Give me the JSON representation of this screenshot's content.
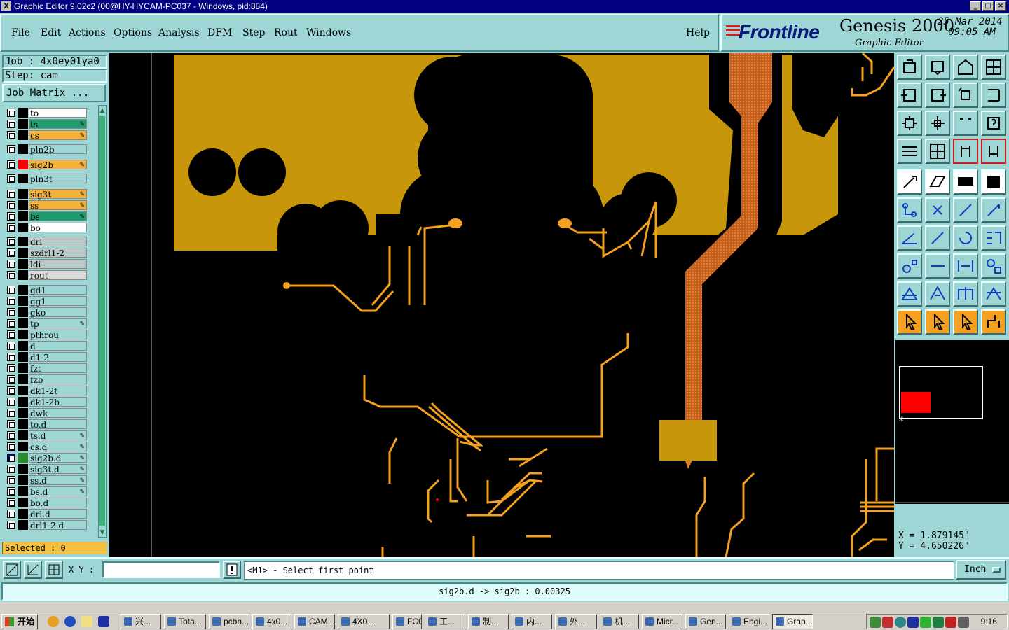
{
  "window": {
    "title": "Graphic Editor 9.02c2 (00@HY-HYCAM-PC037 - Windows, pid:884)"
  },
  "menu": [
    "File",
    "Edit",
    "Actions",
    "Options",
    "Analysis",
    "DFM",
    "Step",
    "Rout",
    "Windows"
  ],
  "help_label": "Help",
  "brand": {
    "logo": "Frontline",
    "product": "Genesis 2000",
    "subtitle": "Graphic Editor",
    "date": "25 Mar 2014",
    "time": "09:05 AM"
  },
  "job": {
    "job_line": "Job : 4x0ey01ya0",
    "step_line": "Step: cam",
    "matrix_button": "Job Matrix ..."
  },
  "layers": [
    {
      "name": "to",
      "color": "#000000",
      "bg": "#ffffff",
      "edit": false
    },
    {
      "name": "ts",
      "color": "#000000",
      "bg": "#1f9c6c",
      "edit": true
    },
    {
      "name": "cs",
      "color": "#000000",
      "bg": "#f4b23a",
      "edit": true
    },
    {
      "name": "pln2b",
      "color": "#000000",
      "bg": "#9ed6d6",
      "edit": false
    },
    {
      "name": "sig2b",
      "color": "#ff0000",
      "bg": "#f4b23a",
      "edit": true
    },
    {
      "name": "pln3t",
      "color": "#000000",
      "bg": "#9ed6d6",
      "edit": false
    },
    {
      "name": "sig3t",
      "color": "#000000",
      "bg": "#f4b23a",
      "edit": true
    },
    {
      "name": "ss",
      "color": "#000000",
      "bg": "#f4b23a",
      "edit": true
    },
    {
      "name": "bs",
      "color": "#000000",
      "bg": "#1f9c6c",
      "edit": true
    },
    {
      "name": "bo",
      "color": "#000000",
      "bg": "#ffffff",
      "edit": false
    },
    {
      "name": "drl",
      "color": "#000000",
      "bg": "#b8c8c8",
      "edit": false
    },
    {
      "name": "szdrl1-2",
      "color": "#000000",
      "bg": "#b8c8c8",
      "edit": false
    },
    {
      "name": "ldi",
      "color": "#000000",
      "bg": "#b8c8c8",
      "edit": false
    },
    {
      "name": "rout",
      "color": "#000000",
      "bg": "#d8d8d8",
      "edit": false
    },
    {
      "name": "gd1",
      "color": "#000000",
      "bg": "#9ed6d6",
      "edit": false
    },
    {
      "name": "gg1",
      "color": "#000000",
      "bg": "#9ed6d6",
      "edit": false
    },
    {
      "name": "gko",
      "color": "#000000",
      "bg": "#9ed6d6",
      "edit": false
    },
    {
      "name": "tp",
      "color": "#000000",
      "bg": "#9ed6d6",
      "edit": true
    },
    {
      "name": "pthrou",
      "color": "#000000",
      "bg": "#9ed6d6",
      "edit": false
    },
    {
      "name": "d",
      "color": "#000000",
      "bg": "#9ed6d6",
      "edit": false
    },
    {
      "name": "d1-2",
      "color": "#000000",
      "bg": "#9ed6d6",
      "edit": false
    },
    {
      "name": "fzt",
      "color": "#000000",
      "bg": "#9ed6d6",
      "edit": false
    },
    {
      "name": "fzb",
      "color": "#000000",
      "bg": "#9ed6d6",
      "edit": false
    },
    {
      "name": "dk1-2t",
      "color": "#000000",
      "bg": "#9ed6d6",
      "edit": false
    },
    {
      "name": "dk1-2b",
      "color": "#000000",
      "bg": "#9ed6d6",
      "edit": false
    },
    {
      "name": "dwk",
      "color": "#000000",
      "bg": "#9ed6d6",
      "edit": false
    },
    {
      "name": "to.d",
      "color": "#000000",
      "bg": "#9ed6d6",
      "edit": false
    },
    {
      "name": "ts.d",
      "color": "#000000",
      "bg": "#9ed6d6",
      "edit": true
    },
    {
      "name": "cs.d",
      "color": "#000000",
      "bg": "#9ed6d6",
      "edit": true
    },
    {
      "name": "sig2b.d",
      "color": "#2a8a2a",
      "bg": "#9ed6d6",
      "edit": true,
      "active": true
    },
    {
      "name": "sig3t.d",
      "color": "#000000",
      "bg": "#9ed6d6",
      "edit": true
    },
    {
      "name": "ss.d",
      "color": "#000000",
      "bg": "#9ed6d6",
      "edit": true
    },
    {
      "name": "bs.d",
      "color": "#000000",
      "bg": "#9ed6d6",
      "edit": true
    },
    {
      "name": "bo.d",
      "color": "#000000",
      "bg": "#9ed6d6",
      "edit": false
    },
    {
      "name": "drl.d",
      "color": "#000000",
      "bg": "#9ed6d6",
      "edit": false
    },
    {
      "name": "drl1-2.d",
      "color": "#000000",
      "bg": "#9ed6d6",
      "edit": false
    }
  ],
  "selected_text": "Selected : 0",
  "cursor": {
    "x": "X = 1.879145\"",
    "y": "Y = 4.650226\""
  },
  "command": {
    "xy_label": "X Y :",
    "prompt": "<M1> - Select first point",
    "units": "Inch"
  },
  "status_text": "sig2b.d -> sig2b : 0.00325",
  "taskbar": {
    "start": "开始",
    "clock": "9:16",
    "buttons": [
      "兴...",
      "Tota...",
      "pcbn...",
      "4x0...",
      "CAM...",
      "4X0...",
      "FCG...",
      "工...",
      "制...",
      "内...",
      "外...",
      "机...",
      "Micr...",
      "Gen...",
      "Engi...",
      "Grap..."
    ]
  },
  "colors": {
    "panel": "#9ed6d6",
    "copper": "#c8960a",
    "trace": "#f4a020",
    "selection": "#ff0000"
  }
}
